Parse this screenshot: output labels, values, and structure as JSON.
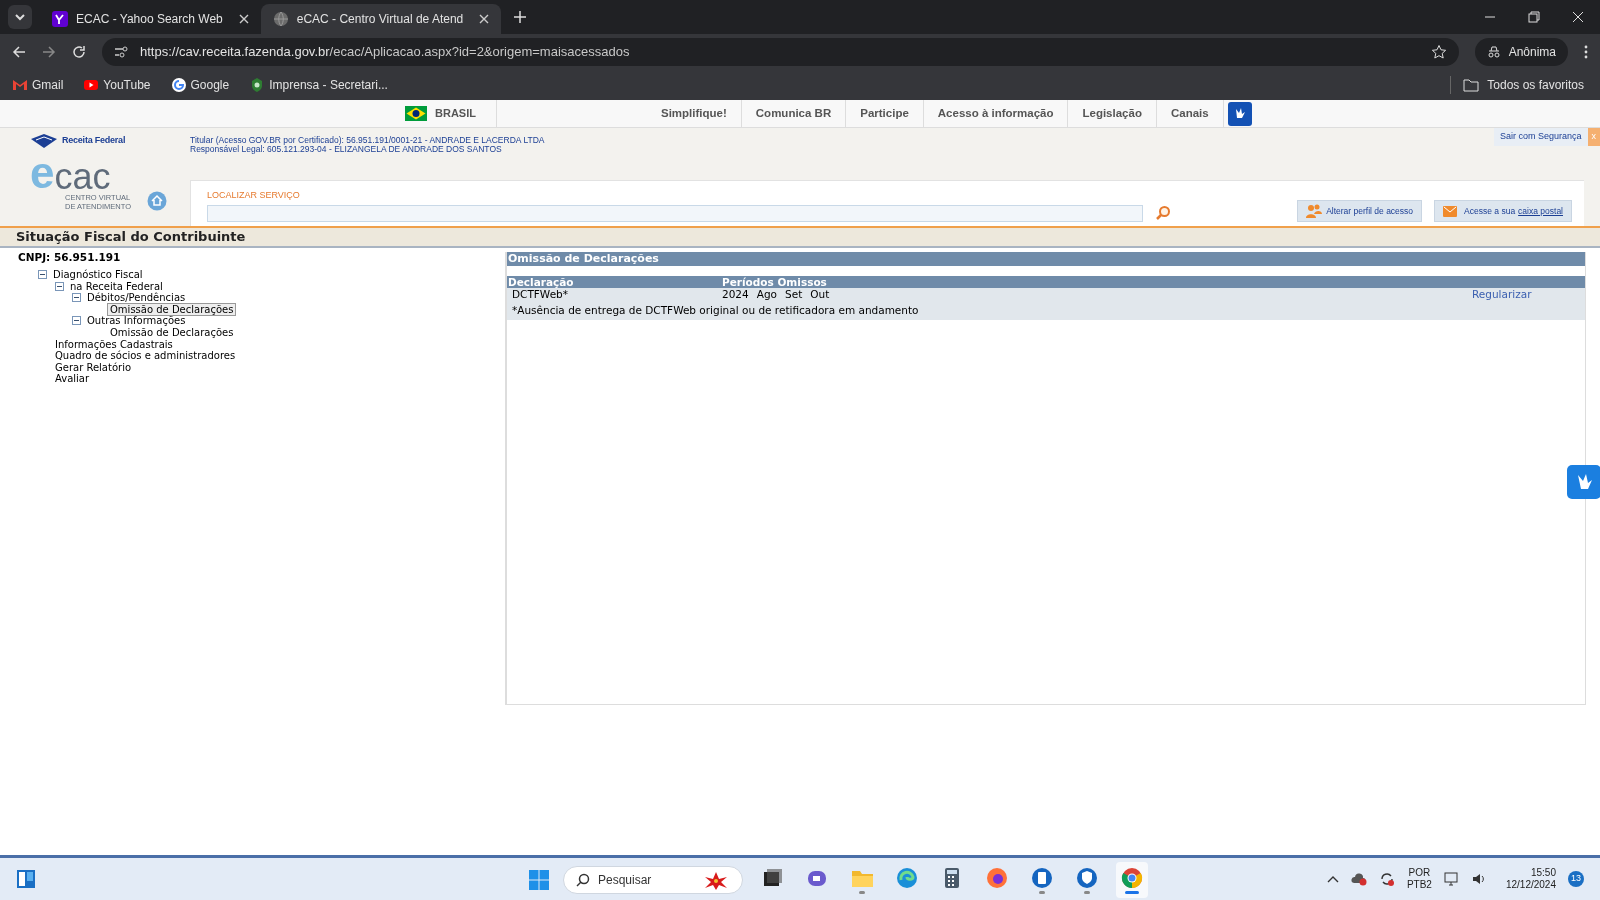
{
  "browser": {
    "tabs": [
      {
        "title": "ECAC - Yahoo Search Web",
        "selected": false,
        "kind": "yahoo"
      },
      {
        "title": "eCAC - Centro Virtual de Atend",
        "selected": true,
        "kind": "globe"
      }
    ],
    "url_host": "https://cav.receita.fazenda.gov.br",
    "url_path": "/ecac/Aplicacao.aspx?id=2&origem=maisacessados",
    "profile": "Anônima",
    "bookmarks": [
      {
        "label": "Gmail",
        "kind": "gmail"
      },
      {
        "label": "YouTube",
        "kind": "youtube"
      },
      {
        "label": "Google",
        "kind": "google"
      },
      {
        "label": "Imprensa - Secretari...",
        "kind": "seal"
      }
    ],
    "bookmarks_folder": "Todos os favoritos"
  },
  "gov_bar": {
    "brand": "BRASIL",
    "links": [
      "Simplifique!",
      "Comunica BR",
      "Participe",
      "Acesso à informação",
      "Legislação",
      "Canais"
    ]
  },
  "header": {
    "agency": "Receita Federal",
    "logo_word": "cac",
    "logo_letter": "e",
    "logo_sub": [
      "CENTRO VIRTUAL",
      "DE ATENDIMENTO"
    ],
    "titular": "Titular (Acesso GOV.BR por Certificado): 56.951.191/0001-21 - ANDRADE E LACERDA LTDA",
    "responsavel": "Responsável Legal: 605.121.293-04 - ELIZANGELA DE ANDRADE DOS SANTOS",
    "logout": "Sair com Segurança",
    "logout_close": "x",
    "search_label": "LOCALIZAR SERVIÇO",
    "profile_button": "Alterar perfil de acesso",
    "mailbox_prefix": "Acesse a sua",
    "mailbox_link": "caixa postal"
  },
  "page_title": "Situação Fiscal do Contribuinte",
  "cnpj": "CNPJ: 56.951.191",
  "tree": [
    {
      "label": "Diagnóstico Fiscal",
      "expanded": true,
      "selected": false,
      "children": [
        {
          "label": "na Receita Federal",
          "expanded": true,
          "selected": false,
          "children": [
            {
              "label": "Débitos/Pendências",
              "expanded": true,
              "selected": false,
              "children": [
                {
                  "label": "Omissão de Declarações",
                  "selected": true
                }
              ]
            },
            {
              "label": "Outras Informações",
              "expanded": true,
              "selected": false,
              "children": [
                {
                  "label": "Omissão de Declarações",
                  "selected": false
                }
              ]
            }
          ]
        }
      ]
    },
    {
      "label": "Informações Cadastrais",
      "selected": false
    },
    {
      "label": "Quadro de sócios e administradores",
      "selected": false
    },
    {
      "label": "Gerar Relatório",
      "selected": false
    },
    {
      "label": "Avaliar",
      "selected": false
    }
  ],
  "panel": {
    "title": "Omissão de Declarações",
    "columns": [
      "Declaração",
      "Períodos Omissos"
    ],
    "rows": [
      {
        "declaration": "DCTFWeb*",
        "periods": [
          "2024",
          "Ago",
          "Set",
          "Out"
        ],
        "action": "Regularizar"
      }
    ],
    "note": "*Ausência de entrega de DCTFWeb original ou de retificadora em andamento"
  },
  "taskbar": {
    "search_placeholder": "Pesquisar",
    "apps": [
      {
        "kind": "window",
        "running": false,
        "active": false
      },
      {
        "kind": "chat",
        "running": false,
        "active": false
      },
      {
        "kind": "folder",
        "running": true,
        "active": false
      },
      {
        "kind": "edge",
        "running": false,
        "active": false
      },
      {
        "kind": "calculator",
        "running": false,
        "active": false
      },
      {
        "kind": "firefox",
        "running": false,
        "active": false
      },
      {
        "kind": "phone",
        "running": true,
        "active": false
      },
      {
        "kind": "shield",
        "running": true,
        "active": false
      },
      {
        "kind": "chrome",
        "running": true,
        "active": true
      }
    ],
    "language": "POR",
    "layout": "PTB2",
    "time": "15:50",
    "date": "12/12/2024",
    "notifications": "13"
  }
}
